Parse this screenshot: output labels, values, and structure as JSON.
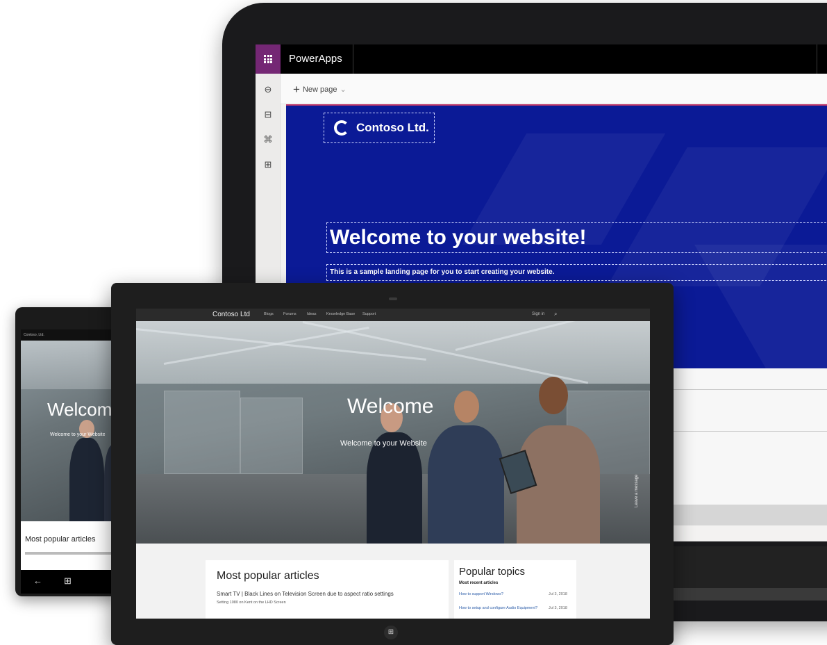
{
  "laptop": {
    "app_title": "PowerApps",
    "new_page_label": "New page",
    "site_logo_text": "Contoso Ltd.",
    "hero_heading": "Welcome to your website!",
    "hero_subtext": "This is a sample landing page for you to start creating your website."
  },
  "phone": {
    "site_name": "Contoso, Ltd.",
    "welcome": "Welcome",
    "welcome_sub": "Welcome to your Website",
    "section_title": "Most popular articles"
  },
  "tablet": {
    "site_name": "Contoso Ltd",
    "nav": [
      "Blogs",
      "Forums",
      "Ideas",
      "Knowledge Base",
      "Support"
    ],
    "sign_in": "Sign in",
    "welcome": "Welcome",
    "welcome_sub": "Welcome to your Website",
    "leave_message": "Leave a message",
    "articles": {
      "title": "Most popular articles",
      "line1": "Smart TV | Black Lines on Television Screen due to aspect ratio settings",
      "line2": "Setting 1080 on Kent on the LHD Screen"
    },
    "topics": {
      "title": "Popular topics",
      "subtitle": "Most recent articles",
      "items": [
        {
          "label": "How to support Windows?",
          "date": "Jul 3, 2018"
        },
        {
          "label": "How to setup and configure Audio Equipment?",
          "date": "Jul 3, 2018"
        }
      ]
    }
  },
  "colors": {
    "powerapps_purple": "#742774",
    "hero_blue": "#0b1a96",
    "device_black": "#1e1e1e"
  }
}
